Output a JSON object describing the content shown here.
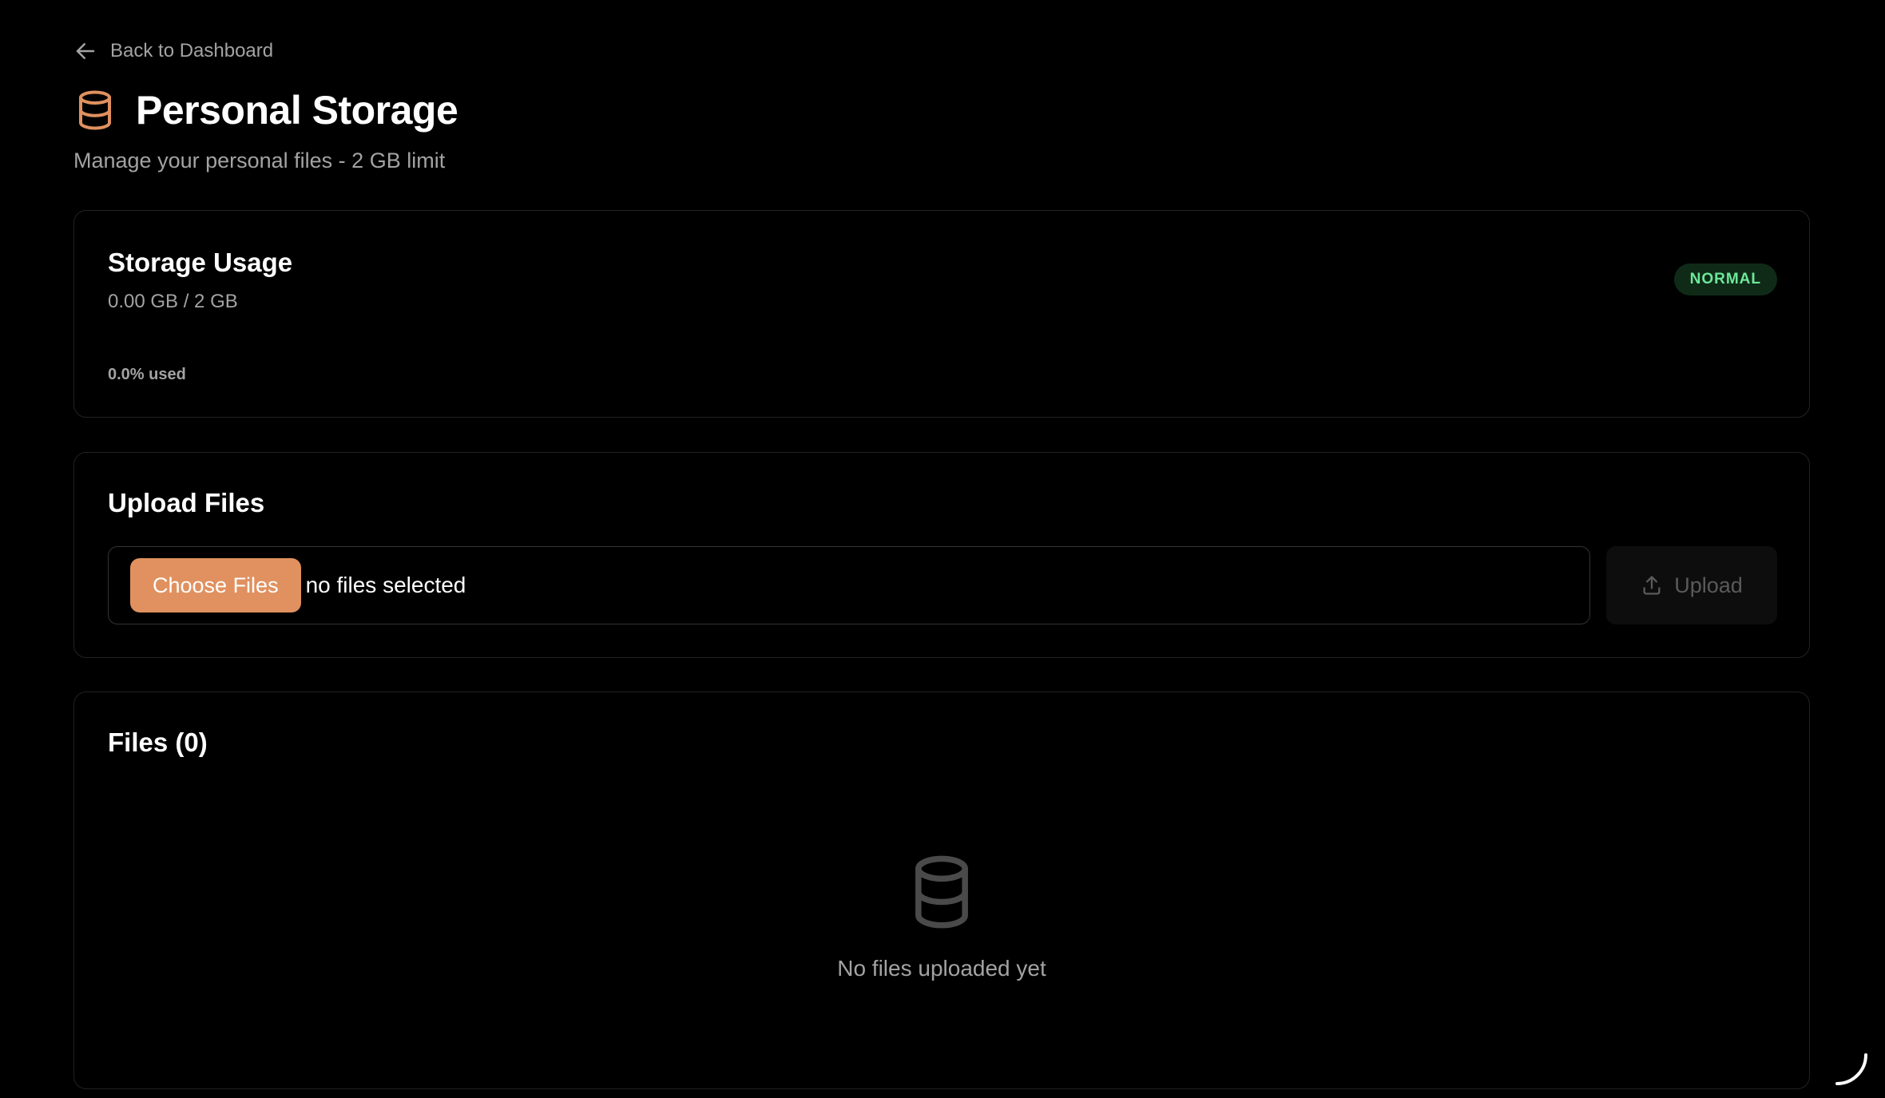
{
  "nav": {
    "back_label": "Back to Dashboard"
  },
  "header": {
    "title": "Personal Storage",
    "subtitle": "Manage your personal files - 2 GB limit",
    "icon": "database-icon"
  },
  "usage": {
    "title": "Storage Usage",
    "amount": "0.00 GB / 2 GB",
    "percent_label": "0.0% used",
    "percent_value": 0.0,
    "status": "NORMAL"
  },
  "upload": {
    "title": "Upload Files",
    "choose_label": "Choose Files",
    "file_status": "no files selected",
    "upload_label": "Upload"
  },
  "files": {
    "title": "Files (0)",
    "empty_message": "No files uploaded yet"
  },
  "colors": {
    "background": "#000000",
    "accent": "#e0915f",
    "muted_text": "#a3a3a3",
    "status_badge_bg": "#0f2b17",
    "status_badge_text": "#6ee79a"
  }
}
